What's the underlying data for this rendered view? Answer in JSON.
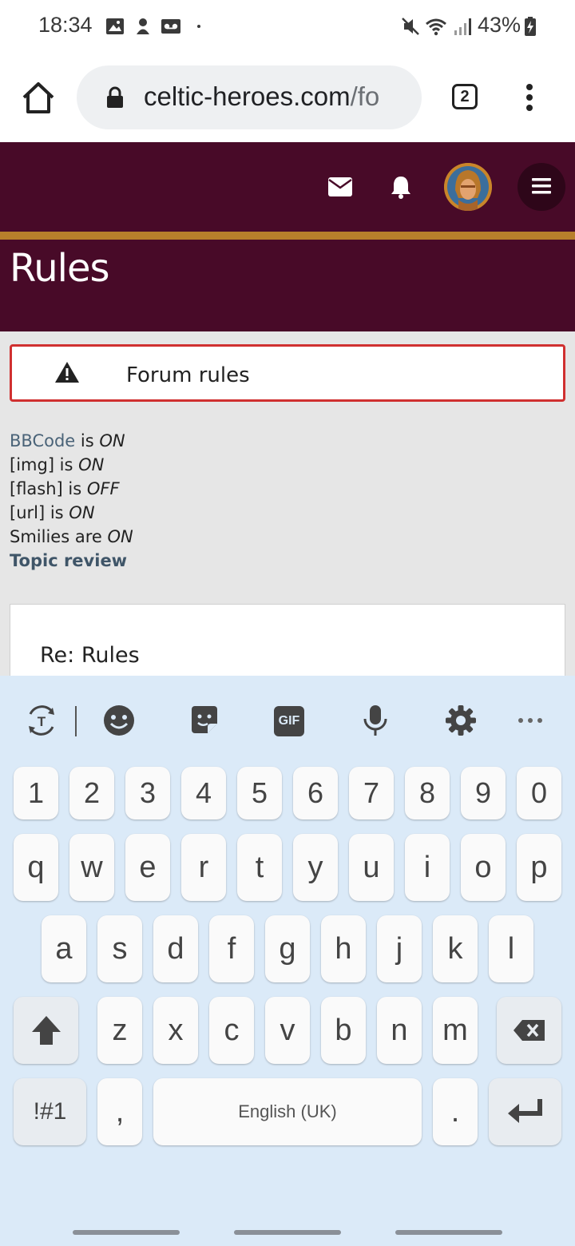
{
  "status_bar": {
    "time": "18:34",
    "battery": "43%",
    "icons": [
      "gallery-icon",
      "app-notification-icon",
      "voicemail-icon",
      "dot-icon",
      "mute-icon",
      "wifi-icon",
      "signal-icon",
      "battery-charging-icon"
    ]
  },
  "browser": {
    "url_domain": "celtic-heroes.com",
    "url_path": "/fo",
    "tab_count": "2",
    "icons": [
      "home-icon",
      "lock-icon",
      "more-vert-icon"
    ]
  },
  "site_header": {
    "icons": [
      "mail-icon",
      "bell-icon",
      "hamburger-icon"
    ],
    "accent_color": "#480a28",
    "strip_color": "#b87f2b"
  },
  "page": {
    "title": "Rules",
    "forum_rules_label": "Forum rules",
    "bbcode_link": "BBCode",
    "bbcode_is": " is ",
    "bbcode_state": "ON",
    "img_label": "[img] is ",
    "img_state": "ON",
    "flash_label": "[flash] is ",
    "flash_state": "OFF",
    "url_label": "[url] is ",
    "url_state": "ON",
    "smilies_label": "Smilies are ",
    "smilies_state": "ON",
    "topic_review": "Topic review",
    "review_title": "Re: Rules"
  },
  "keyboard": {
    "toolbar_icons": [
      "translate-icon",
      "emoji-icon",
      "sticker-icon",
      "gif-icon",
      "microphone-icon",
      "settings-icon",
      "more-horiz-icon"
    ],
    "gif_label": "GIF",
    "row_numbers": [
      "1",
      "2",
      "3",
      "4",
      "5",
      "6",
      "7",
      "8",
      "9",
      "0"
    ],
    "row_q": [
      "q",
      "w",
      "e",
      "r",
      "t",
      "y",
      "u",
      "i",
      "o",
      "p"
    ],
    "row_a": [
      "a",
      "s",
      "d",
      "f",
      "g",
      "h",
      "j",
      "k",
      "l"
    ],
    "row_z": [
      "z",
      "x",
      "c",
      "v",
      "b",
      "n",
      "m"
    ],
    "symbols_label": "!#1",
    "comma_label": ",",
    "space_label": "English (UK)",
    "period_label": "."
  }
}
